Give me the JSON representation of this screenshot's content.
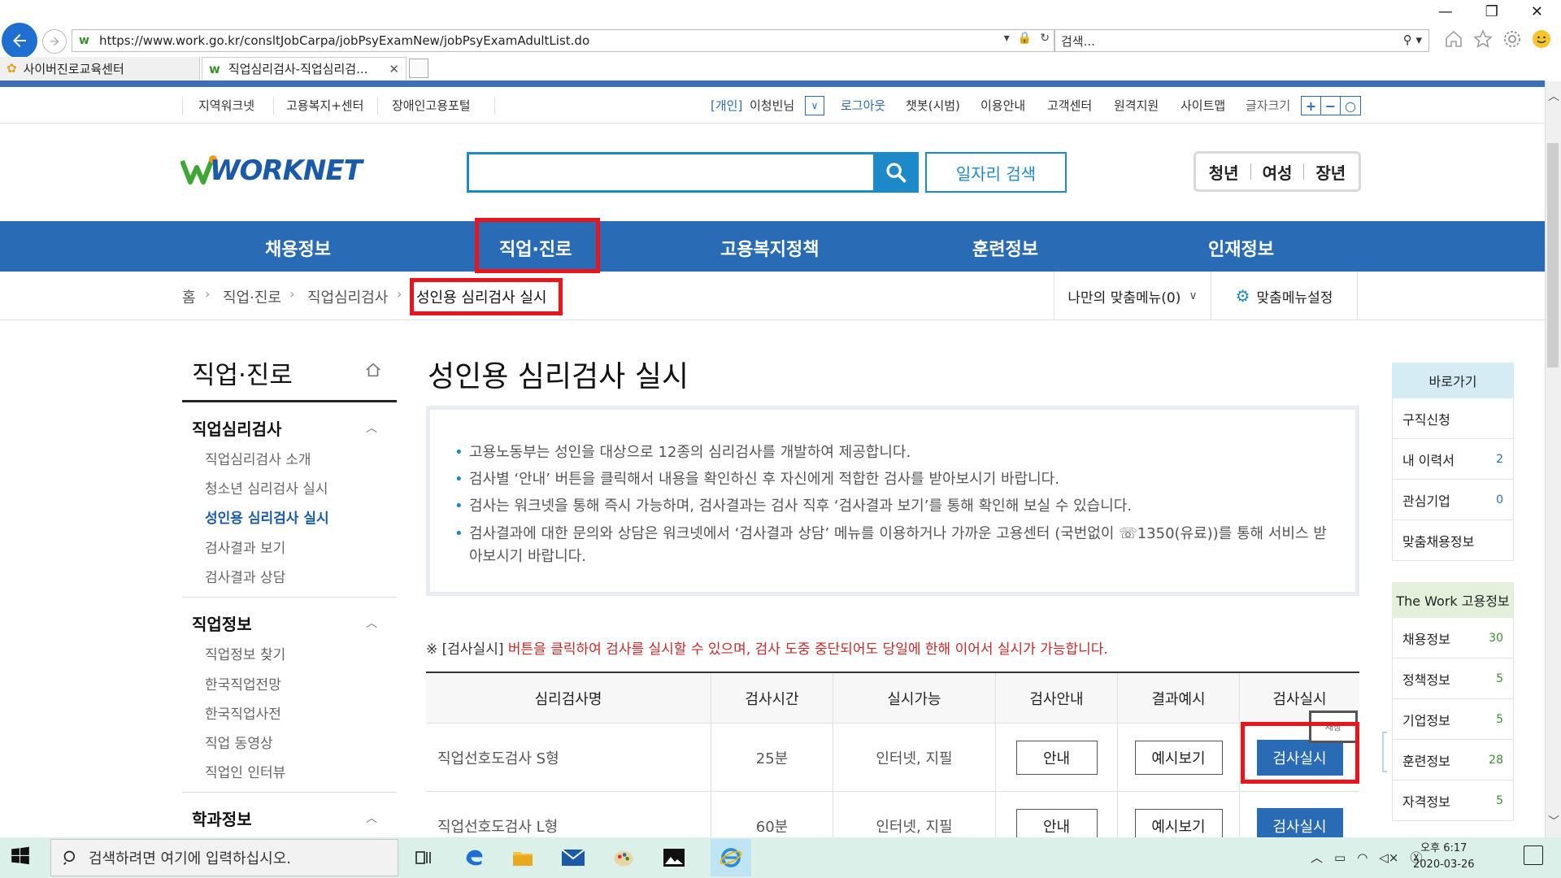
{
  "browser": {
    "url": "https://www.work.go.kr/consltJobCarpa/jobPsyExamNew/jobPsyExamAdultList.do",
    "search_placeholder": "검색...",
    "tabs": [
      {
        "label": "사이버진로교육센터"
      },
      {
        "label": "직업심리검사-직업심리검..."
      }
    ]
  },
  "util": {
    "left": [
      "지역워크넷",
      "고용복지+센터",
      "장애인고용포털"
    ],
    "user_type": "[개인]",
    "user_name": "이청빈님",
    "right": [
      "로그아웃",
      "챗봇(시범)",
      "이용안내",
      "고객센터",
      "원격지원",
      "사이트맵",
      "글자크기"
    ],
    "font_ctrl": [
      "+",
      "−",
      "○"
    ]
  },
  "header": {
    "logo": "WORKNET",
    "job_search_label": "일자리 검색",
    "age_tabs": [
      "청년",
      "여성",
      "장년"
    ]
  },
  "gnb": [
    "채용정보",
    "직업·진로",
    "고용복지정책",
    "훈련정보",
    "인재정보"
  ],
  "breadcrumb": [
    "홈",
    "직업·진로",
    "직업심리검사",
    "성인용 심리검사 실시"
  ],
  "my_menu": {
    "label": "나만의 맞춤메뉴(0)"
  },
  "menu_setting": {
    "label": "맞춤메뉴설정"
  },
  "lnb": {
    "title": "직업·진로",
    "groups": [
      {
        "title": "직업심리검사",
        "items": [
          "직업심리검사 소개",
          "청소년 심리검사 실시",
          "성인용 심리검사 실시",
          "검사결과 보기",
          "검사결과 상담"
        ]
      },
      {
        "title": "직업정보",
        "items": [
          "직업정보 찾기",
          "한국직업전망",
          "한국직업사전",
          "직업 동영상",
          "직업인 인터뷰"
        ]
      },
      {
        "title": "학과정보",
        "items": []
      }
    ]
  },
  "content": {
    "title": "성인용 심리검사 실시",
    "info": [
      "고용노동부는 성인을 대상으로 12종의 심리검사를 개발하여 제공합니다.",
      "검사별 ‘안내’ 버튼을 클릭해서 내용을 확인하신 후 자신에게 적합한 검사를 받아보시기 바랍니다.",
      "검사는 워크넷을 통해 즉시 가능하며, 검사결과는 검사 직후 ‘검사결과 보기’를 통해 확인해 보실 수 있습니다.",
      "검사결과에 대한 문의와 상담은 워크넷에서 ‘검사결과 상담’ 메뉴를 이용하거나 가까운 고용센터 (국번없이 ☏1350(유료))를 통해 서비스 받아보시기 바랍니다."
    ],
    "notice_prefix": "※ [검사실시]",
    "notice_rest": " 버튼을 클릭하여 검사를 실시할 수 있으며, 검사 도중 중단되어도 당일에 한해 이어서 실시가 가능합니다.",
    "table": {
      "headers": [
        "심리검사명",
        "검사시간",
        "실시가능",
        "검사안내",
        "결과예시",
        "검사실시"
      ],
      "rows": [
        {
          "name": "직업선호도검사 S형",
          "time": "25분",
          "mode": "인터넷, 지필",
          "guide": "안내",
          "example": "예시보기",
          "run": "검사실시"
        },
        {
          "name": "직업선호도검사 L형",
          "time": "60분",
          "mode": "인터넷, 지필",
          "guide": "안내",
          "example": "예시보기",
          "run": "검사실시"
        }
      ]
    },
    "tooltip": "새창"
  },
  "quick": {
    "head1": "바로가기",
    "items1": [
      {
        "label": "구직신청",
        "count": ""
      },
      {
        "label": "내 이력서",
        "count": "2"
      },
      {
        "label": "관심기업",
        "count": "0"
      },
      {
        "label": "맞춤채용정보",
        "count": ""
      }
    ],
    "head2": "The Work 고용정보",
    "items2": [
      {
        "label": "채용정보",
        "count": "30"
      },
      {
        "label": "정책정보",
        "count": "5"
      },
      {
        "label": "기업정보",
        "count": "5"
      },
      {
        "label": "훈련정보",
        "count": "28"
      },
      {
        "label": "자격정보",
        "count": "5"
      }
    ]
  },
  "taskbar": {
    "search_placeholder": "검색하려면 여기에 입력하십시오.",
    "time": "오후 6:17",
    "date": "2020-03-26"
  },
  "colors": {
    "primary": "#2a6bb5",
    "accent": "#1e89c9",
    "highlight": "#e8161c",
    "notice": "#c62828"
  }
}
